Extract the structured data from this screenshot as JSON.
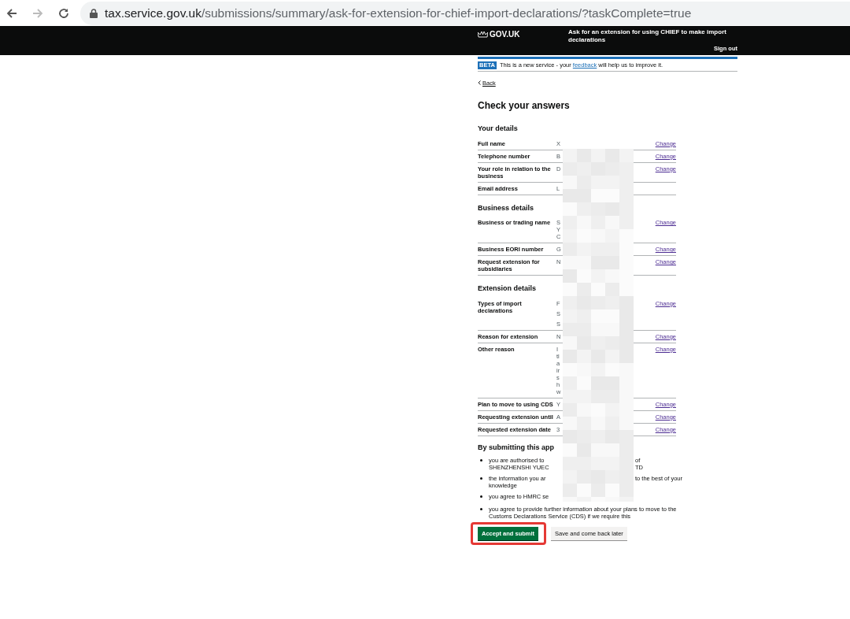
{
  "browser": {
    "url_host": "tax.service.gov.uk",
    "url_path": "/submissions/summary/ask-for-extension-for-chief-import-declarations/?taskComplete=true"
  },
  "header": {
    "logo": "GOV.UK",
    "service_name": "Ask for an extension for using CHIEF to make import declarations",
    "sign_out": "Sign out"
  },
  "phase_banner": {
    "tag": "BETA",
    "text_before": "This is a new service - your",
    "link": "feedback",
    "text_after": "will help us to improve it."
  },
  "back_link": "Back",
  "heading": "Check your answers",
  "sections": [
    {
      "heading": "Your details",
      "rows": [
        {
          "key": "Full name",
          "value_lines": [
            "X"
          ],
          "action": "Change"
        },
        {
          "key": "Telephone number",
          "value_lines": [
            "B"
          ],
          "action": "Change"
        },
        {
          "key": "Your role in relation to the business",
          "value_lines": [
            "D"
          ],
          "action": "Change"
        },
        {
          "key": "Email address",
          "value_lines": [
            "L"
          ]
        }
      ]
    },
    {
      "heading": "Business details",
      "rows": [
        {
          "key": "Business or trading name",
          "value_lines": [
            "S",
            "Y",
            "C"
          ],
          "action": "Change"
        },
        {
          "key": "Business EORI number",
          "value_lines": [
            "G"
          ],
          "action": "Change"
        },
        {
          "key": "Request extension for subsidiaries",
          "value_lines": [
            "N"
          ],
          "action": "Change"
        }
      ]
    },
    {
      "heading": "Extension details",
      "rows": [
        {
          "key": "Types of import declarations",
          "value_paragraphs": [
            "F",
            "S",
            "S"
          ],
          "action": "Change"
        },
        {
          "key": "Reason for extension",
          "value_lines": [
            "N"
          ],
          "action": "Change"
        },
        {
          "key": "Other reason",
          "value_lines": [
            "I",
            "tl",
            "a",
            "ir",
            "s",
            "h",
            "w"
          ],
          "action": "Change"
        },
        {
          "key": "Plan to move to using CDS",
          "value_lines": [
            "Y"
          ],
          "action": "Change"
        },
        {
          "key": "Requesting extension until",
          "value_lines": [
            "A"
          ],
          "action": "Change"
        },
        {
          "key": "Requested extension date",
          "value_lines": [
            "3"
          ],
          "action": "Change"
        }
      ]
    }
  ],
  "declaration": {
    "heading": "By submitting this app",
    "bullets": [
      {
        "lines": [
          {
            "left": "you are authorised to",
            "right": "of"
          },
          {
            "left": "SHENZHENSHI YUEC",
            "right": "TD"
          }
        ]
      },
      {
        "lines": [
          {
            "left": "the information you ar",
            "right": "to the best of your"
          },
          {
            "left": "knowledge"
          }
        ]
      },
      {
        "lines": [
          {
            "left": "you agree to HMRC se"
          }
        ]
      },
      {
        "lines": [
          {
            "full": "you agree to provide further information about your plans to move to the"
          },
          {
            "full": "Customs Declarations Service (CDS) if we require this"
          }
        ]
      }
    ]
  },
  "buttons": [
    {
      "label": "Accept and submit",
      "kind": "primary"
    },
    {
      "label": "Save and come back later",
      "kind": "secondary"
    }
  ]
}
